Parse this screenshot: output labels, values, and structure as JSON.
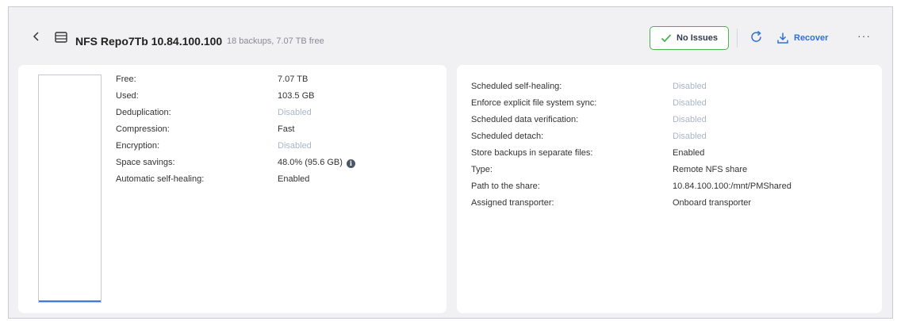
{
  "header": {
    "title": "NFS Repo7Tb 10.84.100.100",
    "subtitle": "18 backups, 7.07 TB free",
    "status_label": "No Issues",
    "recover_label": "Recover",
    "more_label": "···"
  },
  "left_panel": {
    "usage_fraction": 0.007,
    "rows": [
      {
        "label": "Free:",
        "value": "7.07 TB",
        "disabled": false
      },
      {
        "label": "Used:",
        "value": "103.5 GB",
        "disabled": false
      },
      {
        "label": "Deduplication:",
        "value": "Disabled",
        "disabled": true
      },
      {
        "label": "Compression:",
        "value": "Fast",
        "disabled": false
      },
      {
        "label": "Encryption:",
        "value": "Disabled",
        "disabled": true
      },
      {
        "label": "Space savings:",
        "value": "48.0% (95.6 GB)",
        "disabled": false
      },
      {
        "label": "Automatic self-healing:",
        "value": "Enabled",
        "disabled": false
      }
    ]
  },
  "right_panel": {
    "rows": [
      {
        "label": "Scheduled self-healing:",
        "value": "Disabled",
        "disabled": true
      },
      {
        "label": "Enforce explicit file system sync:",
        "value": "Disabled",
        "disabled": true
      },
      {
        "label": "Scheduled data verification:",
        "value": "Disabled",
        "disabled": true
      },
      {
        "label": "Scheduled detach:",
        "value": "Disabled",
        "disabled": true
      },
      {
        "label": "Store backups in separate files:",
        "value": "Enabled",
        "disabled": false
      },
      {
        "label": "Type:",
        "value": "Remote NFS share",
        "disabled": false
      },
      {
        "label": "Path to the share:",
        "value": "10.84.100.100:/mnt/PMShared",
        "disabled": false
      },
      {
        "label": "Assigned transporter:",
        "value": "Onboard transporter",
        "disabled": false
      }
    ]
  },
  "colors": {
    "accent": "#2f6fd6",
    "status_ok": "#4caf50",
    "disabled_text": "#a9b6c8",
    "usage_bar": "#3f7fe0"
  },
  "icons": {
    "back": "chevron-left-icon",
    "repo": "repository-icon",
    "status": "checkmark-icon",
    "refresh": "refresh-icon",
    "recover": "download-icon",
    "more": "more-icon",
    "info": "info-icon"
  }
}
